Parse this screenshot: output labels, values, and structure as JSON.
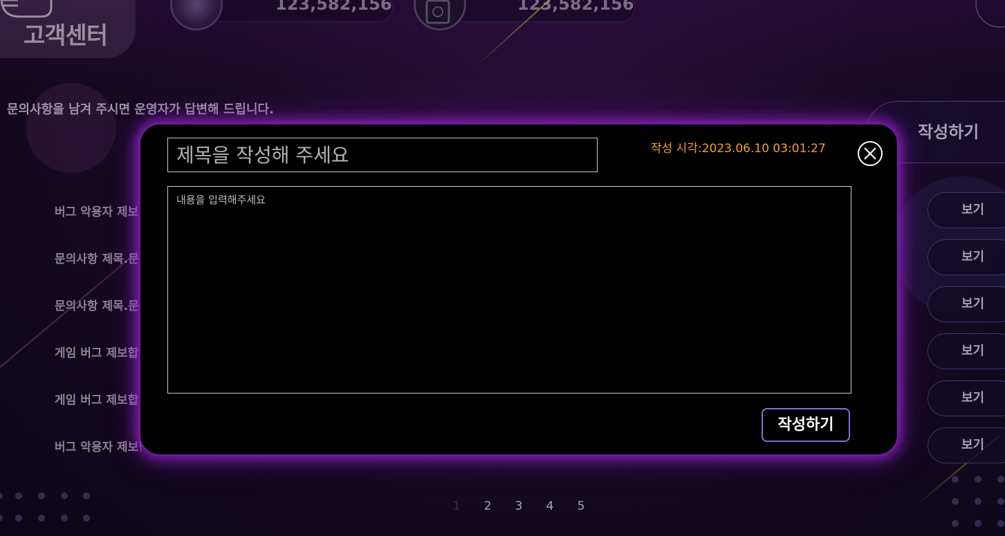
{
  "header": {
    "title": "고객센터",
    "stats": [
      {
        "icon": "chip-icon",
        "value": "123,582,156"
      },
      {
        "icon": "safe-icon",
        "value": "123,582,156"
      }
    ]
  },
  "notice": "문의사항을 남겨 주시면 운영자가 답변해 드립니다.",
  "write_tab_label": "작성하기",
  "list": {
    "rows": [
      {
        "title": "버그 악용자 제보합니다",
        "action": "보기"
      },
      {
        "title": "문의사항 제목.문의사항",
        "action": "보기"
      },
      {
        "title": "문의사항 제목.문의사항",
        "action": "보기"
      },
      {
        "title": "게임 버그 제보합니다",
        "action": "보기"
      },
      {
        "title": "게임 버그 제보합니다",
        "action": "보기"
      },
      {
        "title": "버그 악용자 제보합니다",
        "action": "보기"
      }
    ]
  },
  "pagination": {
    "pages": [
      "1",
      "2",
      "3",
      "4",
      "5"
    ],
    "current": "1"
  },
  "modal": {
    "title_placeholder": "제목을 작성해 주세요",
    "title_value": "",
    "written_time": "작성 시각:2023.06.10 03:01:27",
    "content_placeholder": "내용을 입력해주세요",
    "content_value": "",
    "submit_label": "작성하기",
    "close_icon": "close-icon"
  },
  "colors": {
    "accent_glow": "#aa28dc",
    "time_text": "#f0a030",
    "submit_border": "#8a6ed8"
  }
}
